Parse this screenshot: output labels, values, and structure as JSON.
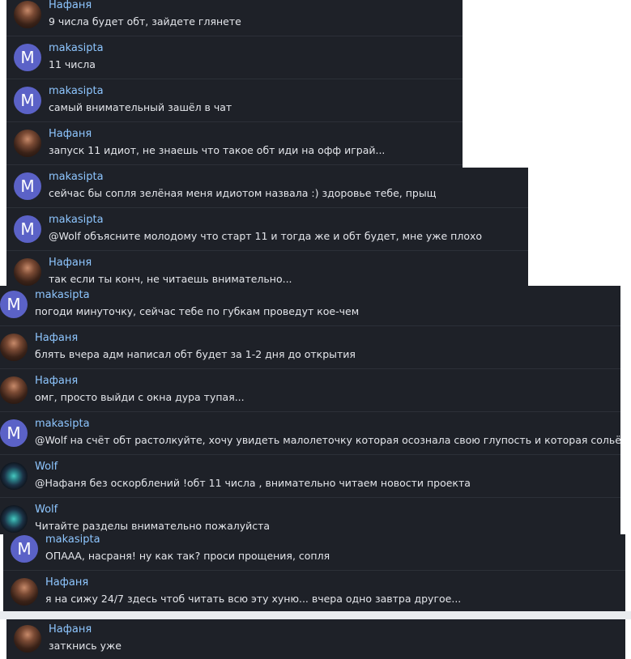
{
  "theme": {
    "background": "#1e2128",
    "author_color": "#8ec6ff",
    "text_color": "#e4e6eb",
    "avatar_m_color": "#5b62c7"
  },
  "messages": [
    {
      "author": "Нафаня",
      "avatar": "nafanya-avatar-icon",
      "text": "9 числа будет обт, зайдете глянете"
    },
    {
      "author": "makasipta",
      "avatar_letter": "M",
      "text": "11 числа"
    },
    {
      "author": "makasipta",
      "avatar_letter": "M",
      "text": "самый внимательный зашёл в чат"
    },
    {
      "author": "Нафаня",
      "avatar": "nafanya-avatar-icon",
      "text": "запуск 11 идиот, не знаешь что такое обт иди на офф играй..."
    },
    {
      "author": "makasipta",
      "avatar_letter": "M",
      "text": "сейчас бы сопля зелёная меня идиотом назвала :) здоровье тебе, прыщ"
    },
    {
      "author": "makasipta",
      "avatar_letter": "M",
      "text": "@Wolf объясните молодому что старт 11 и тогда же и обт будет, мне уже плохо"
    },
    {
      "author": "Нафаня",
      "avatar": "nafanya-avatar-icon",
      "text": "так если ты конч, не читаешь внимательно..."
    },
    {
      "author": "makasipta",
      "avatar_letter": "M",
      "text": "погоди минуточку, сейчас тебе по губкам проведут кое-чем"
    },
    {
      "author": "Нафаня",
      "avatar": "nafanya-avatar-icon",
      "text": "блять вчера адм написал обт будет за 1-2 дня до открытия"
    },
    {
      "author": "Нафаня",
      "avatar": "nafanya-avatar-icon",
      "text": "омг, просто выйди с окна дура тупая..."
    },
    {
      "author": "makasipta",
      "avatar_letter": "M",
      "text": "@Wolf на счёт обт растолкуйте, хочу увидеть малолеточку которая осознала свою глупость и которая сольётся"
    },
    {
      "author": "Wolf",
      "avatar": "wolf-avatar-icon",
      "text": "@Нафаня без оскорблений !обт 11 числа , внимательно читаем новости проекта"
    },
    {
      "author": "Wolf",
      "avatar": "wolf-avatar-icon",
      "text": "Читайте разделы внимательно пожалуйста"
    },
    {
      "author": "makasipta",
      "avatar_letter": "M",
      "text": "ОПААА, насраня! ну как так? проси прощения, сопля"
    },
    {
      "author": "Нафаня",
      "avatar": "nafanya-avatar-icon",
      "text": "я на сижу 24/7 здесь чтоб читать всю эту хуню... вчера одно завтра другое..."
    },
    {
      "author": "Нафаня",
      "avatar": "nafanya-avatar-icon",
      "text": "заткнись уже"
    }
  ]
}
